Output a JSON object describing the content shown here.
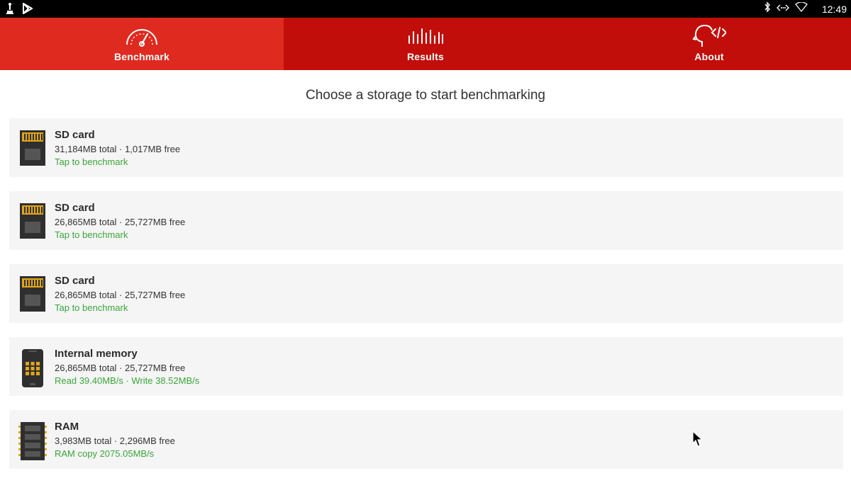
{
  "status_bar": {
    "left_icons": [
      "usb-debug-icon",
      "play-store-icon"
    ],
    "right_icons": [
      "bluetooth-icon",
      "ethernet-icon",
      "wifi-icon"
    ],
    "time": "12:49"
  },
  "tabs": [
    {
      "label": "Benchmark",
      "icon": "speedometer-icon",
      "active": true
    },
    {
      "label": "Results",
      "icon": "bars-icon",
      "active": false
    },
    {
      "label": "About",
      "icon": "head-code-icon",
      "active": false
    }
  ],
  "heading": "Choose a storage to start benchmarking",
  "storages": [
    {
      "icon": "sd-card-icon",
      "title": "SD card",
      "info": "31,184MB total · 1,017MB free",
      "action": "Tap to benchmark"
    },
    {
      "icon": "sd-card-icon",
      "title": "SD card",
      "info": "26,865MB total · 25,727MB free",
      "action": "Tap to benchmark"
    },
    {
      "icon": "sd-card-icon",
      "title": "SD card",
      "info": "26,865MB total · 25,727MB free",
      "action": "Tap to benchmark"
    },
    {
      "icon": "phone-chip-icon",
      "title": "Internal memory",
      "info": "26,865MB total · 25,727MB free",
      "action": "Read 39.40MB/s · Write 38.52MB/s"
    },
    {
      "icon": "ram-stick-icon",
      "title": "RAM",
      "info": "3,983MB total · 2,296MB free",
      "action": "RAM copy 2075.05MB/s"
    }
  ],
  "colors": {
    "tab_bar": "#c20e0a",
    "tab_active": "#df2a20",
    "result_text": "#3aa53a",
    "card_background": "#f5f5f5"
  }
}
